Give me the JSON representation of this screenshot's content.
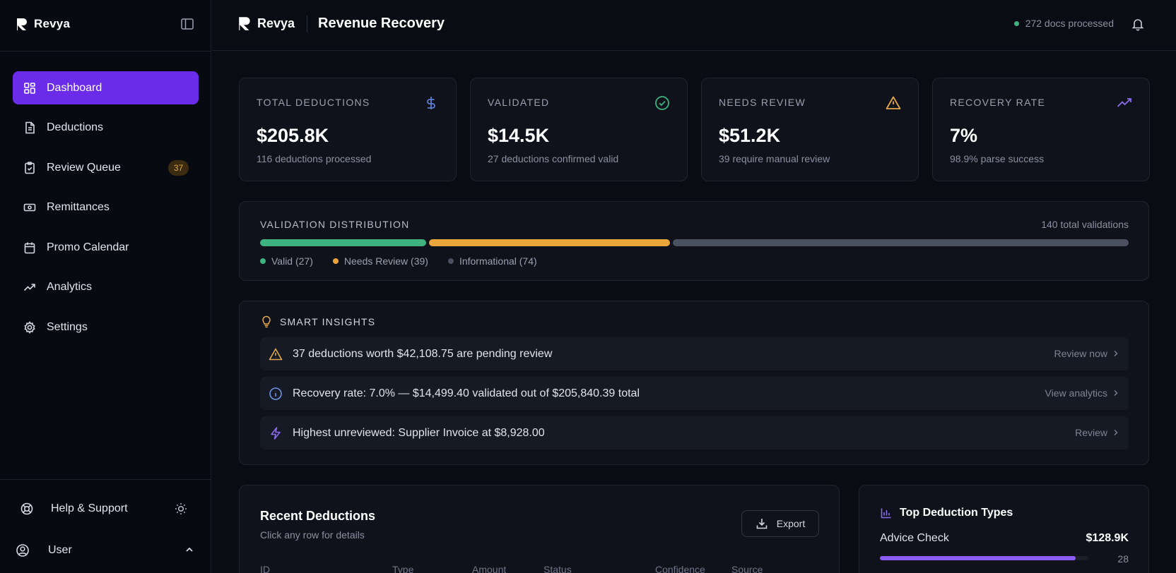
{
  "brand": {
    "name": "Revya"
  },
  "sidebar": {
    "items": [
      {
        "label": "Dashboard",
        "icon": "grid-icon",
        "active": true
      },
      {
        "label": "Deductions",
        "icon": "document-icon"
      },
      {
        "label": "Review Queue",
        "icon": "clipboard-check-icon",
        "badge": "37"
      },
      {
        "label": "Remittances",
        "icon": "banknote-icon"
      },
      {
        "label": "Promo Calendar",
        "icon": "calendar-icon"
      },
      {
        "label": "Analytics",
        "icon": "trending-up-icon"
      },
      {
        "label": "Settings",
        "icon": "gear-icon"
      }
    ],
    "help_label": "Help & Support",
    "user_label": "User"
  },
  "header": {
    "title": "Revenue Recovery",
    "status_text": "272 docs processed"
  },
  "kpis": [
    {
      "label": "TOTAL DEDUCTIONS",
      "value": "$205.8K",
      "sub": "116 deductions processed",
      "icon": "dollar-icon",
      "color": "#5b7fd6"
    },
    {
      "label": "VALIDATED",
      "value": "$14.5K",
      "sub": "27 deductions confirmed valid",
      "icon": "check-circle-icon",
      "color": "#3fb37f"
    },
    {
      "label": "NEEDS REVIEW",
      "value": "$51.2K",
      "sub": "39 require manual review",
      "icon": "warning-icon",
      "color": "#e2a84a"
    },
    {
      "label": "RECOVERY RATE",
      "value": "7%",
      "sub": "98.9% parse success",
      "icon": "trending-up-icon",
      "color": "#8b6cf0"
    }
  ],
  "distribution": {
    "title": "VALIDATION DISTRIBUTION",
    "total_label": "140 total validations",
    "segments": [
      {
        "label": "Valid (27)",
        "value": 27,
        "color": "#3fb37f"
      },
      {
        "label": "Needs Review (39)",
        "value": 39,
        "color": "#eba43b"
      },
      {
        "label": "Informational (74)",
        "value": 74,
        "color": "#4b5060"
      }
    ]
  },
  "insights": {
    "title": "SMART INSIGHTS",
    "rows": [
      {
        "icon": "warning-icon",
        "text": "37 deductions worth $42,108.75 are pending review",
        "action": "Review now"
      },
      {
        "icon": "info-icon",
        "text": "Recovery rate: 7.0% — $14,499.40 validated out of $205,840.39 total",
        "action": "View analytics"
      },
      {
        "icon": "lightning-icon",
        "text": "Highest unreviewed: Supplier Invoice at $8,928.00",
        "action": "Review"
      }
    ]
  },
  "recent": {
    "title": "Recent Deductions",
    "subtitle": "Click any row for details",
    "export_label": "Export",
    "columns": [
      "ID",
      "Type",
      "Amount",
      "Status",
      "Confidence",
      "Source"
    ]
  },
  "top_types": {
    "title": "Top Deduction Types",
    "items": [
      {
        "name": "Advice Check",
        "value": "$128.9K",
        "count": "28",
        "fraction": 0.94
      }
    ]
  },
  "colors": {
    "accent": "#6b2ce9",
    "background": "#0a0c14",
    "card": "#0f121b"
  }
}
